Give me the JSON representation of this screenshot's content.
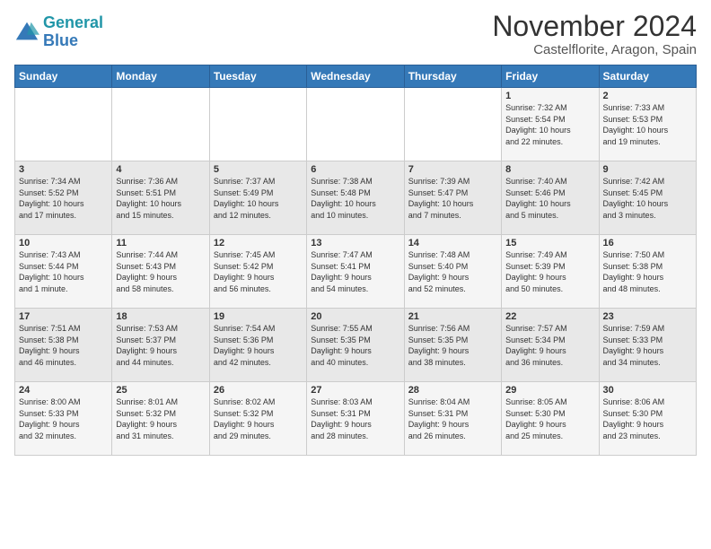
{
  "logo": {
    "line1": "General",
    "line2": "Blue"
  },
  "title": "November 2024",
  "subtitle": "Castelflorite, Aragon, Spain",
  "weekdays": [
    "Sunday",
    "Monday",
    "Tuesday",
    "Wednesday",
    "Thursday",
    "Friday",
    "Saturday"
  ],
  "weeks": [
    [
      {
        "day": "",
        "info": ""
      },
      {
        "day": "",
        "info": ""
      },
      {
        "day": "",
        "info": ""
      },
      {
        "day": "",
        "info": ""
      },
      {
        "day": "",
        "info": ""
      },
      {
        "day": "1",
        "info": "Sunrise: 7:32 AM\nSunset: 5:54 PM\nDaylight: 10 hours\nand 22 minutes."
      },
      {
        "day": "2",
        "info": "Sunrise: 7:33 AM\nSunset: 5:53 PM\nDaylight: 10 hours\nand 19 minutes."
      }
    ],
    [
      {
        "day": "3",
        "info": "Sunrise: 7:34 AM\nSunset: 5:52 PM\nDaylight: 10 hours\nand 17 minutes."
      },
      {
        "day": "4",
        "info": "Sunrise: 7:36 AM\nSunset: 5:51 PM\nDaylight: 10 hours\nand 15 minutes."
      },
      {
        "day": "5",
        "info": "Sunrise: 7:37 AM\nSunset: 5:49 PM\nDaylight: 10 hours\nand 12 minutes."
      },
      {
        "day": "6",
        "info": "Sunrise: 7:38 AM\nSunset: 5:48 PM\nDaylight: 10 hours\nand 10 minutes."
      },
      {
        "day": "7",
        "info": "Sunrise: 7:39 AM\nSunset: 5:47 PM\nDaylight: 10 hours\nand 7 minutes."
      },
      {
        "day": "8",
        "info": "Sunrise: 7:40 AM\nSunset: 5:46 PM\nDaylight: 10 hours\nand 5 minutes."
      },
      {
        "day": "9",
        "info": "Sunrise: 7:42 AM\nSunset: 5:45 PM\nDaylight: 10 hours\nand 3 minutes."
      }
    ],
    [
      {
        "day": "10",
        "info": "Sunrise: 7:43 AM\nSunset: 5:44 PM\nDaylight: 10 hours\nand 1 minute."
      },
      {
        "day": "11",
        "info": "Sunrise: 7:44 AM\nSunset: 5:43 PM\nDaylight: 9 hours\nand 58 minutes."
      },
      {
        "day": "12",
        "info": "Sunrise: 7:45 AM\nSunset: 5:42 PM\nDaylight: 9 hours\nand 56 minutes."
      },
      {
        "day": "13",
        "info": "Sunrise: 7:47 AM\nSunset: 5:41 PM\nDaylight: 9 hours\nand 54 minutes."
      },
      {
        "day": "14",
        "info": "Sunrise: 7:48 AM\nSunset: 5:40 PM\nDaylight: 9 hours\nand 52 minutes."
      },
      {
        "day": "15",
        "info": "Sunrise: 7:49 AM\nSunset: 5:39 PM\nDaylight: 9 hours\nand 50 minutes."
      },
      {
        "day": "16",
        "info": "Sunrise: 7:50 AM\nSunset: 5:38 PM\nDaylight: 9 hours\nand 48 minutes."
      }
    ],
    [
      {
        "day": "17",
        "info": "Sunrise: 7:51 AM\nSunset: 5:38 PM\nDaylight: 9 hours\nand 46 minutes."
      },
      {
        "day": "18",
        "info": "Sunrise: 7:53 AM\nSunset: 5:37 PM\nDaylight: 9 hours\nand 44 minutes."
      },
      {
        "day": "19",
        "info": "Sunrise: 7:54 AM\nSunset: 5:36 PM\nDaylight: 9 hours\nand 42 minutes."
      },
      {
        "day": "20",
        "info": "Sunrise: 7:55 AM\nSunset: 5:35 PM\nDaylight: 9 hours\nand 40 minutes."
      },
      {
        "day": "21",
        "info": "Sunrise: 7:56 AM\nSunset: 5:35 PM\nDaylight: 9 hours\nand 38 minutes."
      },
      {
        "day": "22",
        "info": "Sunrise: 7:57 AM\nSunset: 5:34 PM\nDaylight: 9 hours\nand 36 minutes."
      },
      {
        "day": "23",
        "info": "Sunrise: 7:59 AM\nSunset: 5:33 PM\nDaylight: 9 hours\nand 34 minutes."
      }
    ],
    [
      {
        "day": "24",
        "info": "Sunrise: 8:00 AM\nSunset: 5:33 PM\nDaylight: 9 hours\nand 32 minutes."
      },
      {
        "day": "25",
        "info": "Sunrise: 8:01 AM\nSunset: 5:32 PM\nDaylight: 9 hours\nand 31 minutes."
      },
      {
        "day": "26",
        "info": "Sunrise: 8:02 AM\nSunset: 5:32 PM\nDaylight: 9 hours\nand 29 minutes."
      },
      {
        "day": "27",
        "info": "Sunrise: 8:03 AM\nSunset: 5:31 PM\nDaylight: 9 hours\nand 28 minutes."
      },
      {
        "day": "28",
        "info": "Sunrise: 8:04 AM\nSunset: 5:31 PM\nDaylight: 9 hours\nand 26 minutes."
      },
      {
        "day": "29",
        "info": "Sunrise: 8:05 AM\nSunset: 5:30 PM\nDaylight: 9 hours\nand 25 minutes."
      },
      {
        "day": "30",
        "info": "Sunrise: 8:06 AM\nSunset: 5:30 PM\nDaylight: 9 hours\nand 23 minutes."
      }
    ]
  ]
}
